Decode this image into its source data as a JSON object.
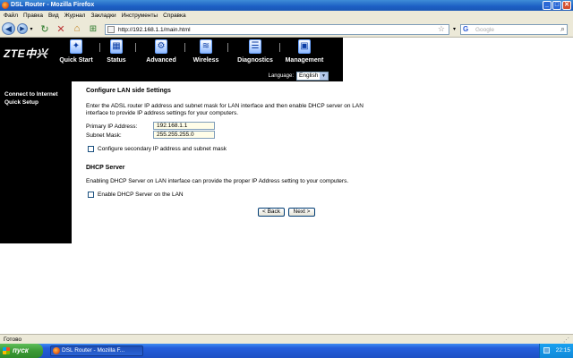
{
  "window": {
    "title": "DSL Router - Mozilla Firefox"
  },
  "menu": [
    "Файл",
    "Правка",
    "Вид",
    "Журнал",
    "Закладки",
    "Инструменты",
    "Справка"
  ],
  "addressbar": {
    "url": "http://192.168.1.1/main.html"
  },
  "searchbar": {
    "placeholder": "Google"
  },
  "router": {
    "logo": "ZTE中兴",
    "nav": [
      {
        "label": "Quick Start",
        "icon": "quick-start-icon"
      },
      {
        "label": "Status",
        "icon": "status-icon"
      },
      {
        "label": "Advanced",
        "icon": "advanced-icon"
      },
      {
        "label": "Wireless",
        "icon": "wireless-icon"
      },
      {
        "label": "Diagnostics",
        "icon": "diagnostics-icon"
      },
      {
        "label": "Management",
        "icon": "management-icon"
      }
    ],
    "language_label": "Language:",
    "language_value": "English",
    "sidebar_item": "Connect to Internet Quick Setup"
  },
  "lan": {
    "title": "Configure LAN side Settings",
    "description": "Enter the ADSL router IP address and subnet mask for LAN interface and then enable DHCP server on LAN interface to provide IP address settings for your computers.",
    "ip_label": "Primary IP Address:",
    "ip_value": "192.168.1.1",
    "mask_label": "Subnet Mask:",
    "mask_value": "255.255.255.0",
    "secondary_label": "Configure secondary IP address and subnet mask"
  },
  "dhcp": {
    "title": "DHCP Server",
    "description": "Enabling DHCP Server on LAN interface can provide the proper IP Address setting to your computers.",
    "enable_label": "Enable DHCP Server on the LAN"
  },
  "buttons": {
    "back": "< Back",
    "next": "Next >"
  },
  "status": {
    "text": "Готово"
  },
  "taskbar": {
    "start": "пуск",
    "task": "DSL Router - Mozilla F...",
    "clock": "22:15"
  }
}
